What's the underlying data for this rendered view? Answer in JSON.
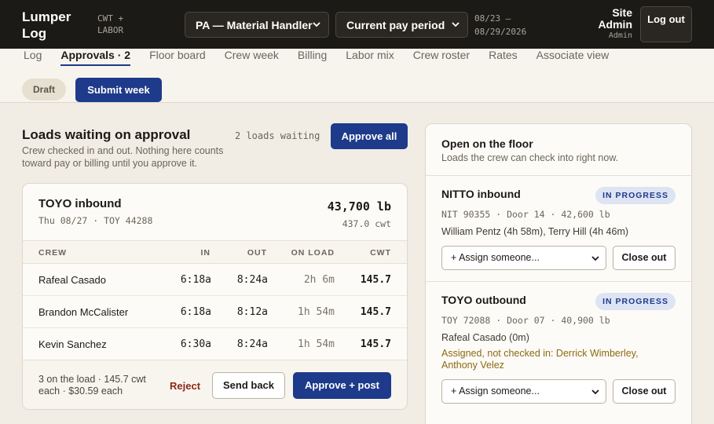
{
  "app": {
    "name": "Lumper Log",
    "tagline": "CWT + LABOR"
  },
  "header": {
    "facility_select": "PA — Material Handler",
    "period_select": "Current pay period",
    "period_start": "08/23 –",
    "period_end": "08/29/2026",
    "user_name": "Site Admin",
    "user_role": "Admin",
    "logout_label": "Log out"
  },
  "nav": {
    "items": [
      {
        "label": "Log"
      },
      {
        "label": "Approvals · 2"
      },
      {
        "label": "Floor board"
      },
      {
        "label": "Crew week"
      },
      {
        "label": "Billing"
      },
      {
        "label": "Labor mix"
      },
      {
        "label": "Crew roster"
      },
      {
        "label": "Rates"
      },
      {
        "label": "Associate view"
      }
    ],
    "active_index": 1
  },
  "toolbar": {
    "status_pill": "Draft",
    "submit_label": "Submit week"
  },
  "approvals": {
    "title": "Loads waiting on approval",
    "subtitle": "Crew checked in and out. Nothing here counts toward pay or billing until you approve it.",
    "waiting_count": "2 loads waiting",
    "approve_all_label": "Approve all",
    "load": {
      "title": "TOYO inbound",
      "meta": "Thu 08/27 · TOY 44288",
      "weight_lb": "43,700 lb",
      "weight_cwt": "437.0 cwt",
      "columns": [
        "CREW",
        "IN",
        "OUT",
        "ON LOAD",
        "CWT"
      ],
      "rows": [
        {
          "name": "Rafeal Casado",
          "in": "6:18a",
          "out": "8:24a",
          "on_load": "2h 6m",
          "cwt": "145.7"
        },
        {
          "name": "Brandon McCalister",
          "in": "6:18a",
          "out": "8:12a",
          "on_load": "1h 54m",
          "cwt": "145.7"
        },
        {
          "name": "Kevin Sanchez",
          "in": "6:30a",
          "out": "8:24a",
          "on_load": "1h 54m",
          "cwt": "145.7"
        }
      ],
      "footer_note": "3 on the load · 145.7 cwt each · $30.59 each",
      "reject_label": "Reject",
      "send_back_label": "Send back",
      "approve_post_label": "Approve + post"
    }
  },
  "floor": {
    "title": "Open on the floor",
    "subtitle": "Loads the crew can check into right now.",
    "loads": [
      {
        "title": "NITTO inbound",
        "status": "IN PROGRESS",
        "meta": "NIT 90355 · Door 14 · 42,600 lb",
        "crew": "William Pentz (4h 58m), Terry Hill (4h 46m)",
        "warning": "",
        "assign_placeholder": "+ Assign someone...",
        "close_label": "Close out"
      },
      {
        "title": "TOYO outbound",
        "status": "IN PROGRESS",
        "meta": "TOY 72088 · Door 07 · 40,900 lb",
        "crew": "Rafeal Casado (0m)",
        "warning": "Assigned, not checked in: Derrick Wimberley, Anthony Velez",
        "assign_placeholder": "+ Assign someone...",
        "close_label": "Close out"
      }
    ]
  },
  "colors": {
    "brand_dark": "#1c1a17",
    "accent_blue": "#1e3a8a",
    "background": "#f1ede4",
    "warning": "#8a6a12",
    "danger": "#8a2a1a"
  },
  "icons": {
    "select_arrow": "chevron-down-icon"
  }
}
